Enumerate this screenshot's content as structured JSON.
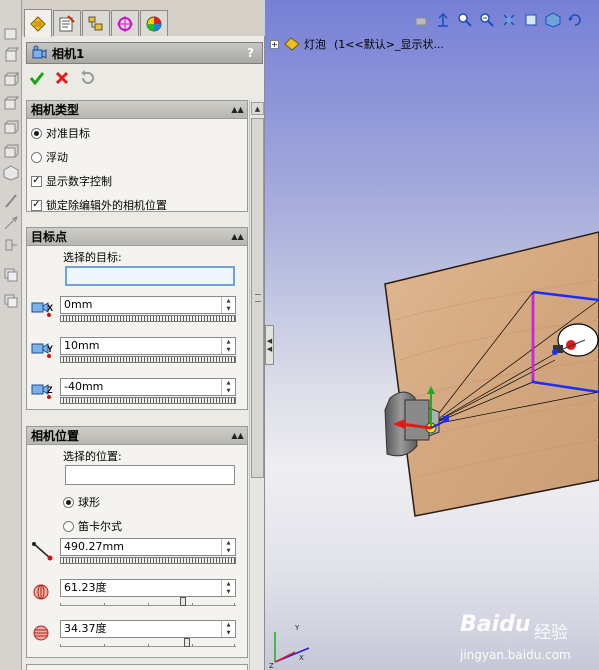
{
  "tabs": [
    {
      "name": "property-manager",
      "active": true
    },
    {
      "name": "configuration-manager",
      "active": false
    },
    {
      "name": "dimxpert-manager",
      "active": false
    },
    {
      "name": "target",
      "active": false
    },
    {
      "name": "display-manager",
      "active": false
    }
  ],
  "pm": {
    "title": "相机1",
    "help": "?"
  },
  "camera_type": {
    "title": "相机类型",
    "aim_at_target": "对准目标",
    "floating": "浮动",
    "show_numeric_controls": "显示数字控制",
    "lock_camera_position": "锁定除编辑外的相机位置"
  },
  "target_point": {
    "title": "目标点",
    "selected_target_label": "选择的目标:",
    "x_value": "0mm",
    "y_value": "10mm",
    "z_value": "-40mm"
  },
  "camera_position": {
    "title": "相机位置",
    "selected_position_label": "选择的位置:",
    "spherical": "球形",
    "cartesian": "笛卡尔式",
    "distance_value": "490.27mm",
    "angle1_value": "61.23度",
    "angle1_level": 0.7,
    "angle2_value": "34.37度",
    "angle2_level": 0.72
  },
  "feature_tree": {
    "expand": "+",
    "label": "灯泡",
    "config": "(1<<默认>_显示状..."
  },
  "watermark": {
    "brand": "Bai",
    "brand_paw": "du",
    "brand_cn": "经验",
    "url": "jingyan.baidu.com"
  },
  "colors": {
    "check_green": "#16a516",
    "cross_red": "#e01c1c",
    "board_wood": "#d7ad86",
    "camera_frame": "#1b2dff",
    "frame_edge": "#e418e4",
    "axis_red": "#e81818",
    "axis_green": "#22aa22",
    "axis_blue": "#2222cc"
  }
}
